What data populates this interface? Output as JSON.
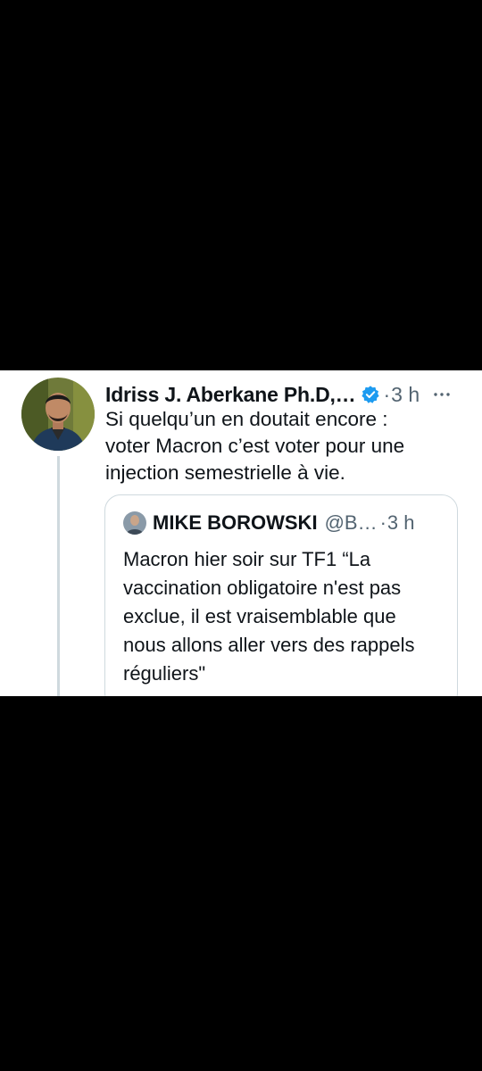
{
  "tweet": {
    "author_name": "Idriss J. Aberkane Ph.D,…",
    "verified_icon": "verified-badge-icon",
    "separator": "·",
    "timestamp": "3 h",
    "more_icon": "ellipsis-icon",
    "text": "Si quelqu’un en doutait encore :\nvoter Macron c’est voter pour une\ninjection semestrielle à vie."
  },
  "quoted_tweet": {
    "author_name": "MIKE BOROWSKI",
    "handle": "@B…",
    "separator": "·",
    "timestamp": "3 h",
    "text": "Macron hier soir sur TF1 “La\nvaccination obligatoire n'est pas\nexclue, il est vraisemblable que\nnous allons aller vers des rappels\nréguliers\""
  },
  "colors": {
    "background": "#000000",
    "card": "#ffffff",
    "text": "#0f1419",
    "secondary": "#536471",
    "verified": "#1d9bf0",
    "border": "#cfd9de"
  }
}
